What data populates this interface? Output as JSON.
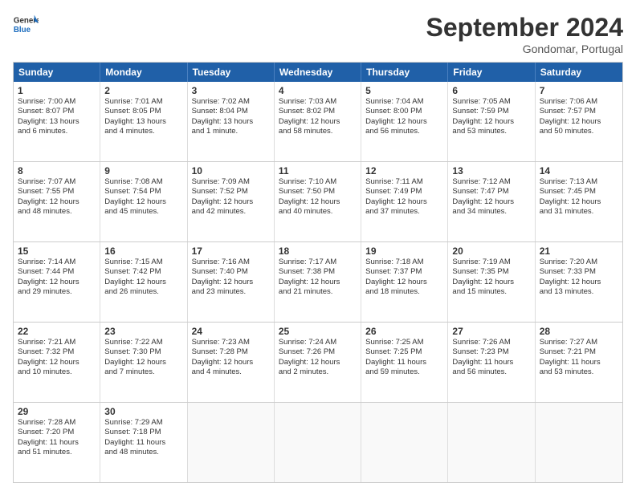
{
  "logo": {
    "line1": "General",
    "line2": "Blue"
  },
  "title": "September 2024",
  "location": "Gondomar, Portugal",
  "weekdays": [
    "Sunday",
    "Monday",
    "Tuesday",
    "Wednesday",
    "Thursday",
    "Friday",
    "Saturday"
  ],
  "rows": [
    [
      {
        "day": "1",
        "lines": [
          "Sunrise: 7:00 AM",
          "Sunset: 8:07 PM",
          "Daylight: 13 hours",
          "and 6 minutes."
        ]
      },
      {
        "day": "2",
        "lines": [
          "Sunrise: 7:01 AM",
          "Sunset: 8:05 PM",
          "Daylight: 13 hours",
          "and 4 minutes."
        ]
      },
      {
        "day": "3",
        "lines": [
          "Sunrise: 7:02 AM",
          "Sunset: 8:04 PM",
          "Daylight: 13 hours",
          "and 1 minute."
        ]
      },
      {
        "day": "4",
        "lines": [
          "Sunrise: 7:03 AM",
          "Sunset: 8:02 PM",
          "Daylight: 12 hours",
          "and 58 minutes."
        ]
      },
      {
        "day": "5",
        "lines": [
          "Sunrise: 7:04 AM",
          "Sunset: 8:00 PM",
          "Daylight: 12 hours",
          "and 56 minutes."
        ]
      },
      {
        "day": "6",
        "lines": [
          "Sunrise: 7:05 AM",
          "Sunset: 7:59 PM",
          "Daylight: 12 hours",
          "and 53 minutes."
        ]
      },
      {
        "day": "7",
        "lines": [
          "Sunrise: 7:06 AM",
          "Sunset: 7:57 PM",
          "Daylight: 12 hours",
          "and 50 minutes."
        ]
      }
    ],
    [
      {
        "day": "8",
        "lines": [
          "Sunrise: 7:07 AM",
          "Sunset: 7:55 PM",
          "Daylight: 12 hours",
          "and 48 minutes."
        ]
      },
      {
        "day": "9",
        "lines": [
          "Sunrise: 7:08 AM",
          "Sunset: 7:54 PM",
          "Daylight: 12 hours",
          "and 45 minutes."
        ]
      },
      {
        "day": "10",
        "lines": [
          "Sunrise: 7:09 AM",
          "Sunset: 7:52 PM",
          "Daylight: 12 hours",
          "and 42 minutes."
        ]
      },
      {
        "day": "11",
        "lines": [
          "Sunrise: 7:10 AM",
          "Sunset: 7:50 PM",
          "Daylight: 12 hours",
          "and 40 minutes."
        ]
      },
      {
        "day": "12",
        "lines": [
          "Sunrise: 7:11 AM",
          "Sunset: 7:49 PM",
          "Daylight: 12 hours",
          "and 37 minutes."
        ]
      },
      {
        "day": "13",
        "lines": [
          "Sunrise: 7:12 AM",
          "Sunset: 7:47 PM",
          "Daylight: 12 hours",
          "and 34 minutes."
        ]
      },
      {
        "day": "14",
        "lines": [
          "Sunrise: 7:13 AM",
          "Sunset: 7:45 PM",
          "Daylight: 12 hours",
          "and 31 minutes."
        ]
      }
    ],
    [
      {
        "day": "15",
        "lines": [
          "Sunrise: 7:14 AM",
          "Sunset: 7:44 PM",
          "Daylight: 12 hours",
          "and 29 minutes."
        ]
      },
      {
        "day": "16",
        "lines": [
          "Sunrise: 7:15 AM",
          "Sunset: 7:42 PM",
          "Daylight: 12 hours",
          "and 26 minutes."
        ]
      },
      {
        "day": "17",
        "lines": [
          "Sunrise: 7:16 AM",
          "Sunset: 7:40 PM",
          "Daylight: 12 hours",
          "and 23 minutes."
        ]
      },
      {
        "day": "18",
        "lines": [
          "Sunrise: 7:17 AM",
          "Sunset: 7:38 PM",
          "Daylight: 12 hours",
          "and 21 minutes."
        ]
      },
      {
        "day": "19",
        "lines": [
          "Sunrise: 7:18 AM",
          "Sunset: 7:37 PM",
          "Daylight: 12 hours",
          "and 18 minutes."
        ]
      },
      {
        "day": "20",
        "lines": [
          "Sunrise: 7:19 AM",
          "Sunset: 7:35 PM",
          "Daylight: 12 hours",
          "and 15 minutes."
        ]
      },
      {
        "day": "21",
        "lines": [
          "Sunrise: 7:20 AM",
          "Sunset: 7:33 PM",
          "Daylight: 12 hours",
          "and 13 minutes."
        ]
      }
    ],
    [
      {
        "day": "22",
        "lines": [
          "Sunrise: 7:21 AM",
          "Sunset: 7:32 PM",
          "Daylight: 12 hours",
          "and 10 minutes."
        ]
      },
      {
        "day": "23",
        "lines": [
          "Sunrise: 7:22 AM",
          "Sunset: 7:30 PM",
          "Daylight: 12 hours",
          "and 7 minutes."
        ]
      },
      {
        "day": "24",
        "lines": [
          "Sunrise: 7:23 AM",
          "Sunset: 7:28 PM",
          "Daylight: 12 hours",
          "and 4 minutes."
        ]
      },
      {
        "day": "25",
        "lines": [
          "Sunrise: 7:24 AM",
          "Sunset: 7:26 PM",
          "Daylight: 12 hours",
          "and 2 minutes."
        ]
      },
      {
        "day": "26",
        "lines": [
          "Sunrise: 7:25 AM",
          "Sunset: 7:25 PM",
          "Daylight: 11 hours",
          "and 59 minutes."
        ]
      },
      {
        "day": "27",
        "lines": [
          "Sunrise: 7:26 AM",
          "Sunset: 7:23 PM",
          "Daylight: 11 hours",
          "and 56 minutes."
        ]
      },
      {
        "day": "28",
        "lines": [
          "Sunrise: 7:27 AM",
          "Sunset: 7:21 PM",
          "Daylight: 11 hours",
          "and 53 minutes."
        ]
      }
    ],
    [
      {
        "day": "29",
        "lines": [
          "Sunrise: 7:28 AM",
          "Sunset: 7:20 PM",
          "Daylight: 11 hours",
          "and 51 minutes."
        ]
      },
      {
        "day": "30",
        "lines": [
          "Sunrise: 7:29 AM",
          "Sunset: 7:18 PM",
          "Daylight: 11 hours",
          "and 48 minutes."
        ]
      },
      {
        "day": "",
        "lines": []
      },
      {
        "day": "",
        "lines": []
      },
      {
        "day": "",
        "lines": []
      },
      {
        "day": "",
        "lines": []
      },
      {
        "day": "",
        "lines": []
      }
    ]
  ]
}
